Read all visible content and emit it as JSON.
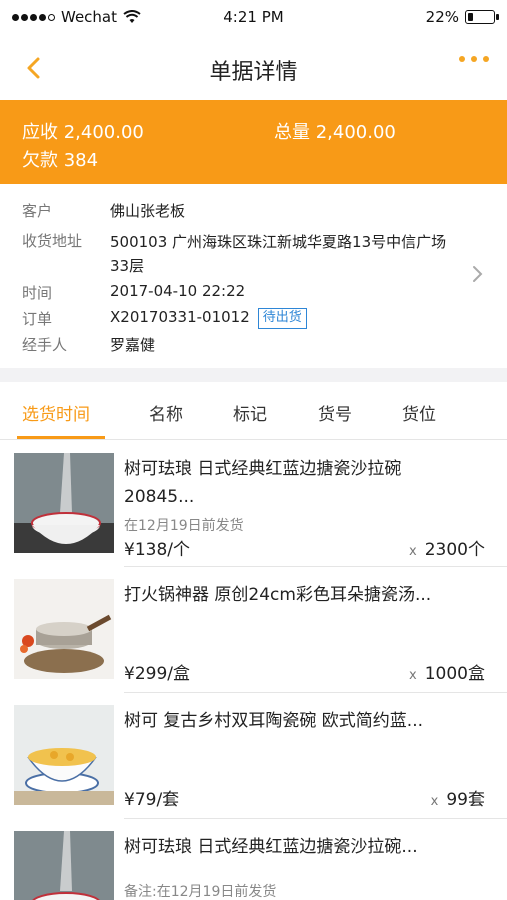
{
  "status_bar": {
    "carrier": "Wechat",
    "time": "4:21 PM",
    "battery": "22%",
    "battery_level": 0.22
  },
  "nav": {
    "title": "单据详情",
    "back_icon": "chevron-left-icon",
    "more_icon": "more-dots-icon"
  },
  "summary": {
    "receivable": "应收 2,400.00",
    "total_qty": "总量 2,400.00",
    "owed": "欠款 384"
  },
  "info": {
    "customer_label": "客户",
    "customer_value": "佛山张老板",
    "address_label": "收货地址",
    "address_value": "500103 广州海珠区珠江新城华夏路13号中信广场33层",
    "time_label": "时间",
    "time_value": "2017-04-10 22:22",
    "order_label": "订单",
    "order_value": "X20170331-01012",
    "order_status": "待出货",
    "handler_label": "经手人",
    "handler_value": "罗嘉健"
  },
  "tabs": [
    "选货时间",
    "名称",
    "标记",
    "货号",
    "货位"
  ],
  "colors": {
    "accent": "#F89A17",
    "link": "#2E86D6"
  },
  "products": [
    {
      "name": "树可珐琅 日式经典红蓝边搪瓷沙拉碗 20845...",
      "note": "在12月19日前发货",
      "price": "¥138/个",
      "qty_prefix": "x",
      "qty": "2300个"
    },
    {
      "name": "打火锅神器 原创24cm彩色耳朵搪瓷汤...",
      "note": "",
      "price": "¥299/盒",
      "qty_prefix": "x",
      "qty": "1000盒"
    },
    {
      "name": "树可 复古乡村双耳陶瓷碗 欧式简约蓝...",
      "note": "",
      "price": "¥79/套",
      "qty_prefix": "x",
      "qty": "99套"
    },
    {
      "name": "树可珐琅 日式经典红蓝边搪瓷沙拉碗...",
      "note": "备注:在12月19日前发货",
      "price": "",
      "qty_prefix": "",
      "qty": ""
    }
  ]
}
